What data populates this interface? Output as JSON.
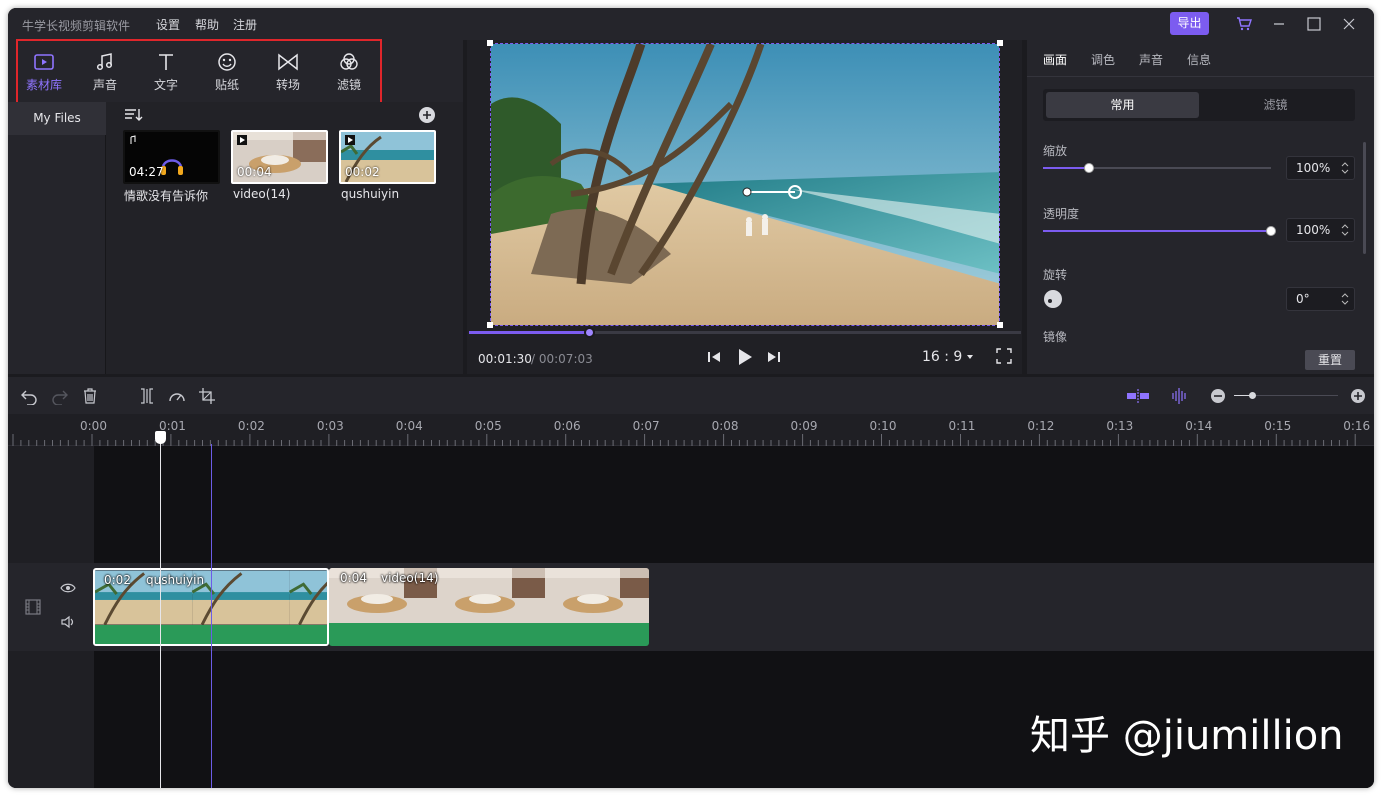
{
  "app": {
    "title": "牛学长视频剪辑软件"
  },
  "menu": [
    "设置",
    "帮助",
    "注册"
  ],
  "header": {
    "export_label": "导出"
  },
  "tools": [
    {
      "label": "素材库",
      "icon": "media-library-icon",
      "active": true
    },
    {
      "label": "声音",
      "icon": "music-note-icon"
    },
    {
      "label": "文字",
      "icon": "text-icon"
    },
    {
      "label": "贴纸",
      "icon": "smiley-sticker-icon"
    },
    {
      "label": "转场",
      "icon": "transition-bowtie-icon"
    },
    {
      "label": "滤镜",
      "icon": "filter-circles-icon"
    }
  ],
  "sidebar": {
    "items": [
      {
        "label": "My Files"
      }
    ]
  },
  "media": {
    "items": [
      {
        "name": "情歌没有告诉你",
        "duration": "04:27",
        "type": "audio"
      },
      {
        "name": "video(14)",
        "duration": "00:04",
        "type": "video"
      },
      {
        "name": "qushuiyin",
        "duration": "00:02",
        "type": "video"
      }
    ]
  },
  "preview": {
    "current_time": "00:01:30",
    "total_time": "/ 00:07:03",
    "aspect_ratio": "16 : 9",
    "progress": 0.22
  },
  "inspector": {
    "tabs": [
      "画面",
      "调色",
      "声音",
      "信息"
    ],
    "segments": [
      "常用",
      "滤镜"
    ],
    "scale": {
      "label": "缩放",
      "value": "100%",
      "level": 0.2
    },
    "opacity": {
      "label": "透明度",
      "value": "100%",
      "level": 1.0
    },
    "rotate": {
      "label": "旋转",
      "value": "0°"
    },
    "mirror": {
      "label": "镜像"
    },
    "reset_label": "重置"
  },
  "timeline": {
    "ruler": [
      "0:00",
      "0:01",
      "0:02",
      "0:03",
      "0:04",
      "0:05",
      "0:06",
      "0:07",
      "0:08",
      "0:09",
      "0:10",
      "0:11",
      "0:12",
      "0:13",
      "0:14",
      "0:15",
      "0:16"
    ],
    "clips": [
      {
        "duration": "0:02",
        "name": "qushuiyin"
      },
      {
        "duration": "0:04",
        "name": "video(14)"
      }
    ]
  },
  "watermark": "知乎 @jiumillion",
  "colors": {
    "accent": "#7c5cf0",
    "clip_green": "#2a9a58",
    "highlight_box": "#e0262b"
  }
}
